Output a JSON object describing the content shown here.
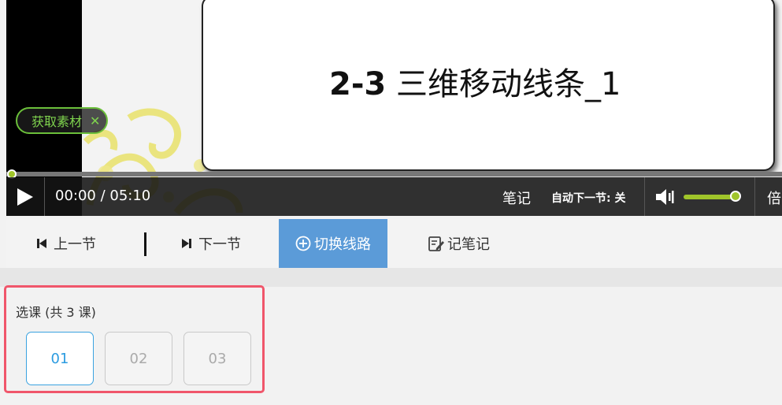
{
  "player": {
    "slide_number": "2-3",
    "slide_title": "三维移动线条_1",
    "material_button": "获取素材",
    "material_close": "✕",
    "time": "00:00 / 05:10",
    "notes": "笔记",
    "autonext": "自动下一节: 关",
    "volume_level": 0.95,
    "speed": "倍",
    "progress": 0
  },
  "nav": {
    "prev": "上一节",
    "next": "下一节",
    "switch_line": "切换线路",
    "take_notes": "记笔记"
  },
  "course_select": {
    "title": "选课 (共 3 课)",
    "lessons": [
      "01",
      "02",
      "03"
    ],
    "active_index": 0
  },
  "colors": {
    "accent_blue": "#5b9bd8",
    "progress_green": "#a0c52a",
    "highlight_red": "#f0566b",
    "material_green": "#7fd34e"
  }
}
